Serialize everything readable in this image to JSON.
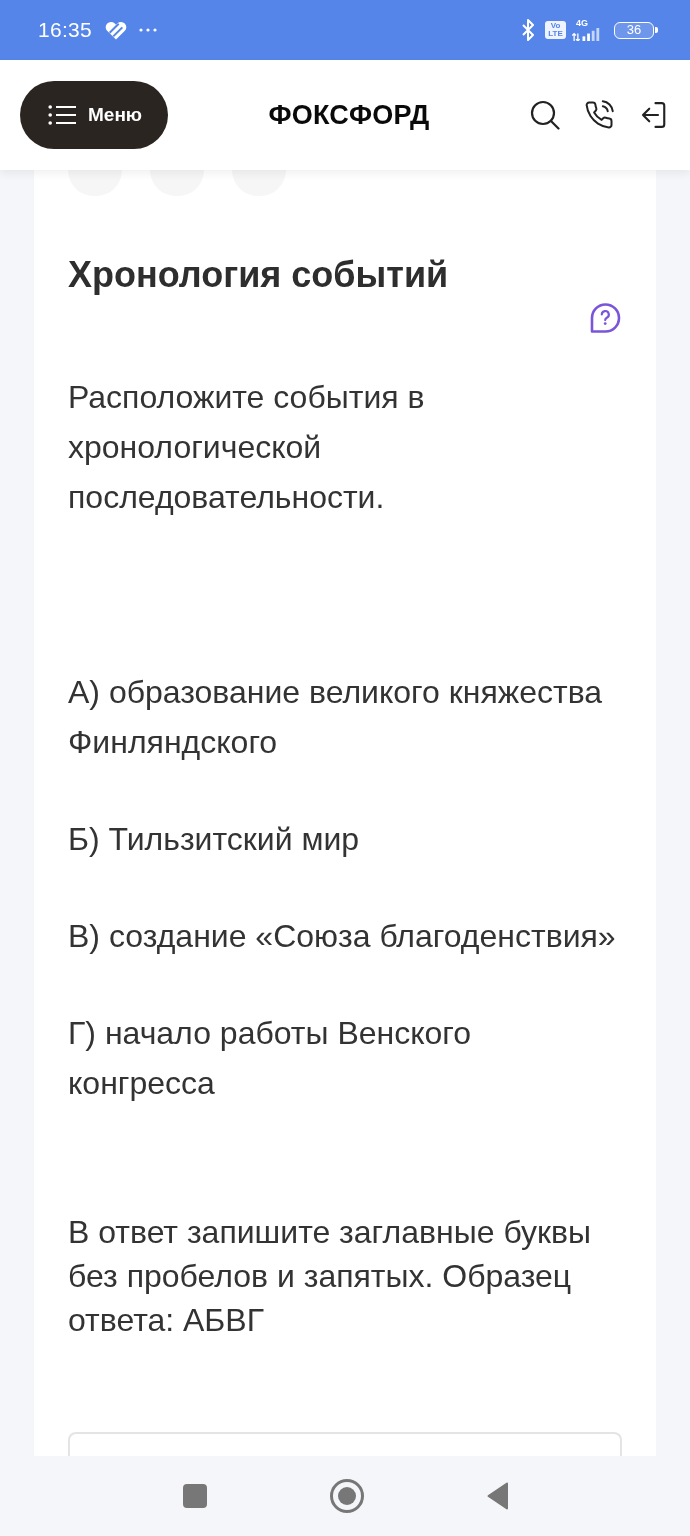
{
  "status_bar": {
    "time": "16:35",
    "volte": "Vo LTE",
    "network": "4G",
    "battery": "36"
  },
  "header": {
    "menu_button": "Меню",
    "logo": "ФОКСФОРД"
  },
  "question_tabs": [
    {
      "selected": false
    },
    {
      "selected": false
    },
    {
      "selected": false
    }
  ],
  "task": {
    "title": "Хронология событий",
    "instruction": "Расположите события в хронологической последовательности.",
    "options": [
      "А) образование великого княжества Финляндского",
      "Б) Тильзитский мир",
      "В) создание «Союза благоденствия»",
      "Г) начало работы Венского конгресса"
    ],
    "answer_note": "В ответ запишите заглавные буквы без пробелов и запятых. Образец ответа: АБВГ"
  }
}
